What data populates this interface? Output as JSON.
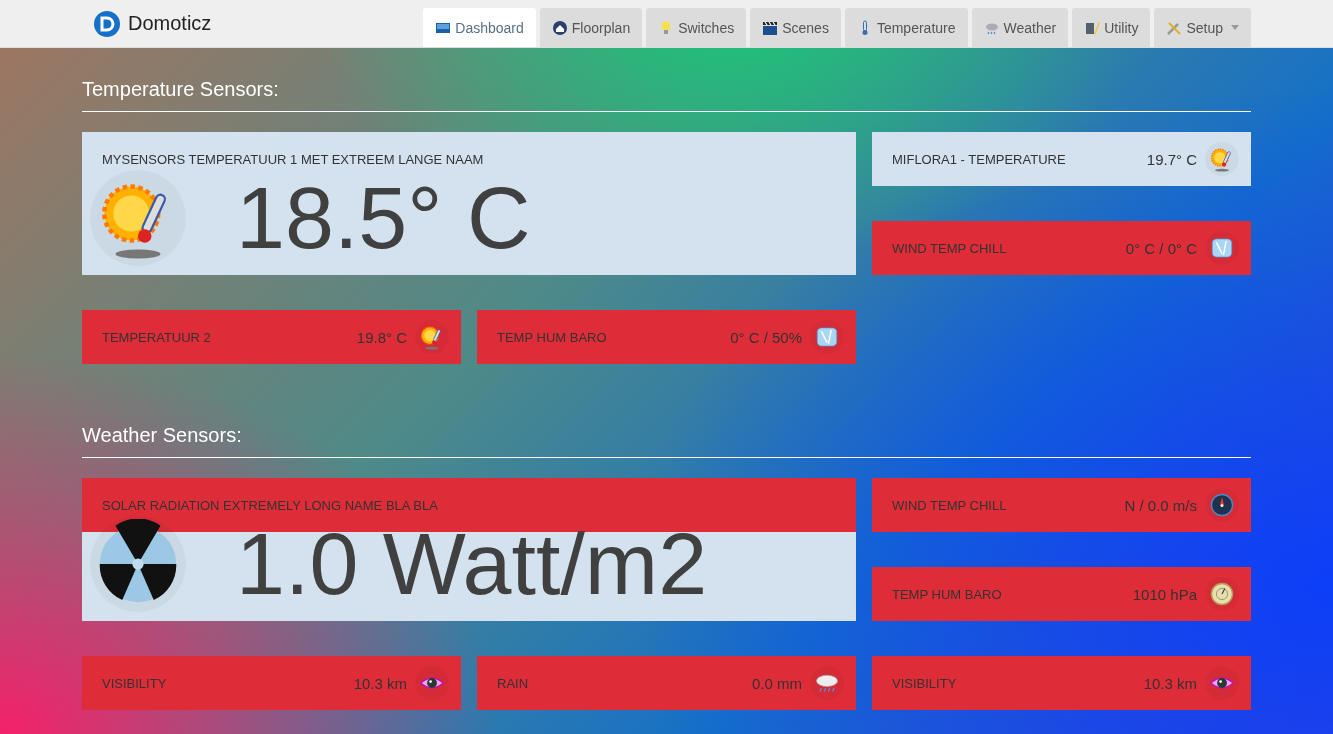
{
  "app": {
    "name": "Domoticz"
  },
  "tabs": [
    {
      "label": "Dashboard",
      "kind": "monitor",
      "selected": true
    },
    {
      "label": "Floorplan",
      "kind": "house",
      "selected": false
    },
    {
      "label": "Switches",
      "kind": "bulb",
      "selected": false
    },
    {
      "label": "Scenes",
      "kind": "clapper",
      "selected": false
    },
    {
      "label": "Temperature",
      "kind": "thermometer",
      "selected": false
    },
    {
      "label": "Weather",
      "kind": "cloud",
      "selected": false
    },
    {
      "label": "Utility",
      "kind": "tools",
      "selected": false
    },
    {
      "label": "Setup",
      "kind": "wrench",
      "selected": false,
      "dropdown": true
    }
  ],
  "sections": [
    {
      "title": "Temperature Sensors:",
      "tiles": [
        {
          "kind": "large",
          "name": "MYSENSORS TEMPERATUUR 1 MET EXTREEM LANGE NAAM",
          "value": "18.5° C",
          "icon": {
            "kind": "sun-thermometer"
          },
          "alert": false
        },
        {
          "kind": "small",
          "name": "MIFLORA1 - TEMPERATURE",
          "value": "19.7° C",
          "icon": {
            "kind": "sun-thermometer"
          },
          "alert": false
        },
        {
          "kind": "small",
          "name": "WIND TEMP CHILL",
          "value": "0° C / 0° C",
          "icon": {
            "kind": "ice"
          },
          "alert": true
        },
        {
          "kind": "small",
          "name": "TEMPERATUUR 2",
          "value": "19.8° C",
          "icon": {
            "kind": "sun-thermometer"
          },
          "alert": true
        },
        {
          "kind": "small",
          "name": "TEMP HUM BARO",
          "value": "0° C / 50%",
          "icon": {
            "kind": "ice"
          },
          "alert": true
        }
      ]
    },
    {
      "title": "Weather Sensors:",
      "tiles": [
        {
          "kind": "large",
          "name": "SOLAR RADIATION EXTREMELY LONG NAME BLA BLA",
          "value": "1.0 Watt/m2",
          "icon": {
            "kind": "radiation"
          },
          "alert": true
        },
        {
          "kind": "small",
          "name": "WIND TEMP CHILL",
          "value": "N / 0.0 m/s",
          "icon": {
            "kind": "compass"
          },
          "alert": true
        },
        {
          "kind": "small",
          "name": "TEMP HUM BARO",
          "value": "1010 hPa",
          "icon": {
            "kind": "barometer"
          },
          "alert": true
        },
        {
          "kind": "small",
          "name": "VISIBILITY",
          "value": "10.3 km",
          "icon": {
            "kind": "eye"
          },
          "alert": true
        },
        {
          "kind": "small",
          "name": "RAIN",
          "value": "0.0 mm",
          "icon": {
            "kind": "rain-cloud"
          },
          "alert": true
        },
        {
          "kind": "small",
          "name": "VISIBILITY",
          "value": "10.3 km",
          "icon": {
            "kind": "eye"
          },
          "alert": true
        }
      ]
    }
  ]
}
